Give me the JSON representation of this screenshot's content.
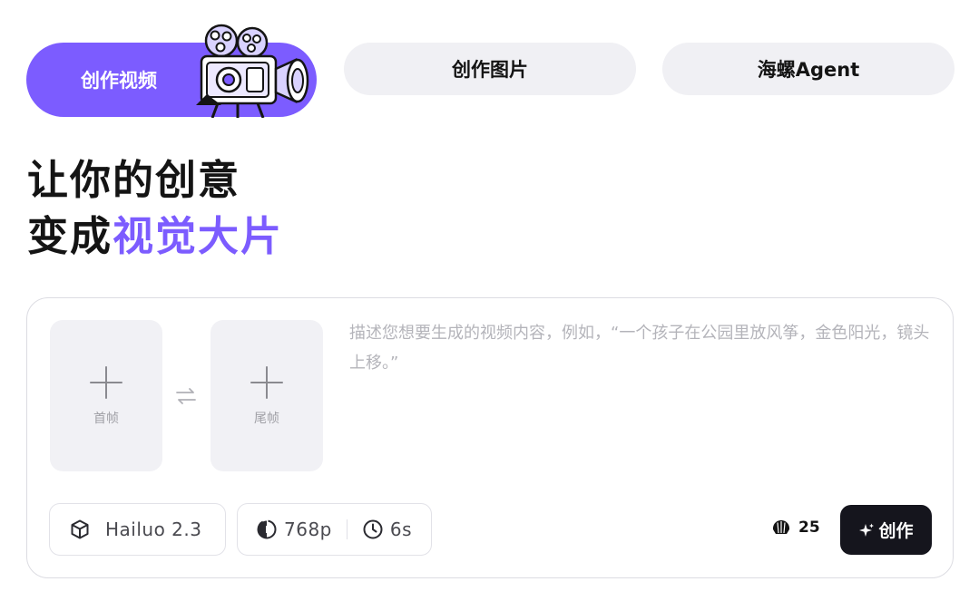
{
  "tabs": [
    {
      "label": "创作视频",
      "active": true
    },
    {
      "label": "创作图片",
      "active": false
    },
    {
      "label": "海螺Agent",
      "active": false
    }
  ],
  "headline": {
    "line1": "让你的创意",
    "line2_prefix": "变成",
    "line2_accent": "视觉大片"
  },
  "composer": {
    "first_frame_label": "首帧",
    "last_frame_label": "尾帧",
    "prompt_value": "",
    "prompt_placeholder": "描述您想要生成的视频内容，例如，“一个孩子在公园里放风筝，金色阳光，镜头上移。”",
    "model": "Hailuo 2.3",
    "resolution": "768p",
    "duration": "6s",
    "credits": "25",
    "create_label": "创作"
  },
  "icons": {
    "tab_illustration": "film-camera-illustration",
    "plus": "plus-icon",
    "swap": "swap-arrows-icon",
    "model": "cube-icon",
    "resolution": "resolution-icon",
    "duration": "clock-icon",
    "credits": "shell-icon",
    "create": "sparkle-icon"
  },
  "colors": {
    "accent": "#7c5cff",
    "tab_inactive_bg": "#f0f0f4",
    "create_button_bg": "#15151d",
    "text_primary": "#141414",
    "placeholder": "#b4b4ba"
  }
}
